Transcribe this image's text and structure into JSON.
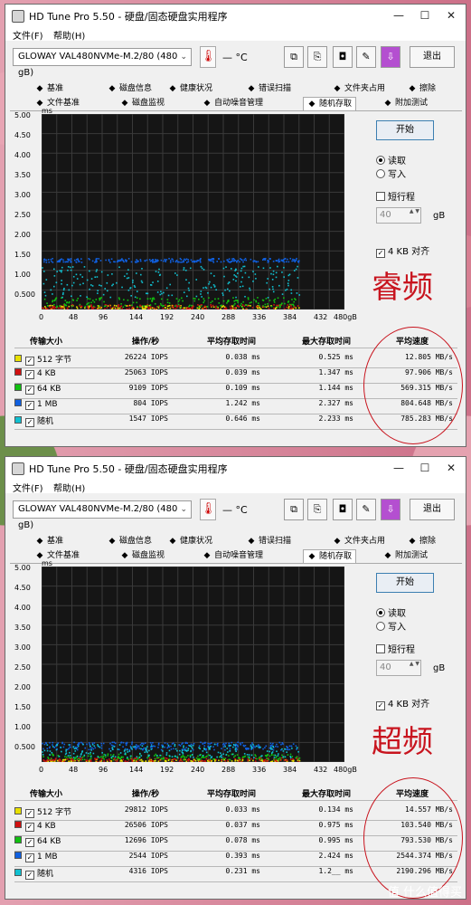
{
  "app": {
    "title": "HD Tune Pro 5.50 - 硬盘/固态硬盘实用程序",
    "menu": [
      "文件(F)",
      "帮助(H)"
    ],
    "drive": "GLOWAY VAL480NVMe-M.2/80 (480 gB)",
    "temperature": "— °C",
    "exit_label": "退出",
    "tabs_row1": [
      {
        "label": "基准",
        "icon": "bulb-icon"
      },
      {
        "label": "磁盘信息",
        "icon": "info-icon"
      },
      {
        "label": "健康状况",
        "icon": "health-icon"
      },
      {
        "label": "错误扫描",
        "icon": "scan-icon"
      },
      {
        "label": "文件夹占用",
        "icon": "folder-icon"
      },
      {
        "label": "擦除",
        "icon": "erase-icon"
      }
    ],
    "tabs_row2": [
      {
        "label": "文件基准",
        "icon": "file-benchmark-icon"
      },
      {
        "label": "磁盘监视",
        "icon": "monitor-icon"
      },
      {
        "label": "自动噪音管理",
        "icon": "sound-icon"
      },
      {
        "label": "随机存取",
        "icon": "random-access-icon",
        "active": true
      },
      {
        "label": "附加测试",
        "icon": "extra-tests-icon"
      }
    ],
    "start_label": "开始",
    "read_label": "读取",
    "write_label": "写入",
    "short_stroke_label": "短行程",
    "short_stroke_value": "40",
    "gb_label": "gB",
    "align_label": "4 KB 对齐",
    "axis_unit": "ms",
    "y_ticks": [
      "5.00",
      "4.50",
      "4.00",
      "3.50",
      "3.00",
      "2.50",
      "2.00",
      "1.50",
      "1.00",
      "0.500"
    ],
    "x_ticks": [
      "0",
      "48",
      "96",
      "144",
      "192",
      "240",
      "288",
      "336",
      "384",
      "432",
      "480gB"
    ],
    "columns": [
      "传输大小",
      "操作/秒",
      "平均存取时间",
      "最大存取时间",
      "平均速度"
    ],
    "row_labels": [
      "512 字节",
      "4 KB",
      "64 KB",
      "1 MB",
      "随机"
    ],
    "row_colors": [
      "#e8e000",
      "#d01010",
      "#10c010",
      "#1060e0",
      "#10c0d0"
    ]
  },
  "panels": [
    {
      "handwritten": "睿频",
      "rows": [
        [
          "26224 IOPS",
          "0.038 ms",
          "0.525 ms",
          "12.805 MB/s"
        ],
        [
          "25063 IOPS",
          "0.039 ms",
          "1.347 ms",
          "97.906 MB/s"
        ],
        [
          "9109 IOPS",
          "0.109 ms",
          "1.144 ms",
          "569.315 MB/s"
        ],
        [
          "804 IOPS",
          "1.242 ms",
          "2.327 ms",
          "804.648 MB/s"
        ],
        [
          "1547 IOPS",
          "0.646 ms",
          "2.233 ms",
          "785.283 MB/s"
        ]
      ]
    },
    {
      "handwritten": "超频",
      "rows": [
        [
          "29812 IOPS",
          "0.033 ms",
          "0.134 ms",
          "14.557 MB/s"
        ],
        [
          "26506 IOPS",
          "0.037 ms",
          "0.975 ms",
          "103.540 MB/s"
        ],
        [
          "12696 IOPS",
          "0.078 ms",
          "0.995 ms",
          "793.530 MB/s"
        ],
        [
          "2544 IOPS",
          "0.393 ms",
          "2.424 ms",
          "2544.374 MB/s"
        ],
        [
          "4316 IOPS",
          "0.231 ms",
          "1.2__ ms",
          "2190.296 MB/s"
        ]
      ]
    }
  ],
  "watermark": "值 什么值得买",
  "chart_data": [
    {
      "type": "scatter",
      "xlabel": "",
      "ylabel": "ms",
      "xlim": [
        0,
        480
      ],
      "ylim": [
        0,
        5
      ],
      "series": [
        {
          "name": "512 字节",
          "y_band": [
            0.0,
            0.1
          ]
        },
        {
          "name": "4 KB",
          "y_band": [
            0.0,
            0.12
          ]
        },
        {
          "name": "64 KB",
          "y_band": [
            0.05,
            0.3
          ]
        },
        {
          "name": "1 MB",
          "y_band": [
            1.2,
            1.3
          ]
        },
        {
          "name": "随机",
          "y_band": [
            0.3,
            1.1
          ]
        }
      ]
    },
    {
      "type": "scatter",
      "xlabel": "",
      "ylabel": "ms",
      "xlim": [
        0,
        480
      ],
      "ylim": [
        0,
        5
      ],
      "series": [
        {
          "name": "512 字节",
          "y_band": [
            0.0,
            0.06
          ]
        },
        {
          "name": "4 KB",
          "y_band": [
            0.0,
            0.1
          ]
        },
        {
          "name": "64 KB",
          "y_band": [
            0.05,
            0.2
          ]
        },
        {
          "name": "1 MB",
          "y_band": [
            0.3,
            0.5
          ]
        },
        {
          "name": "随机",
          "y_band": [
            0.1,
            0.45
          ]
        }
      ]
    }
  ]
}
